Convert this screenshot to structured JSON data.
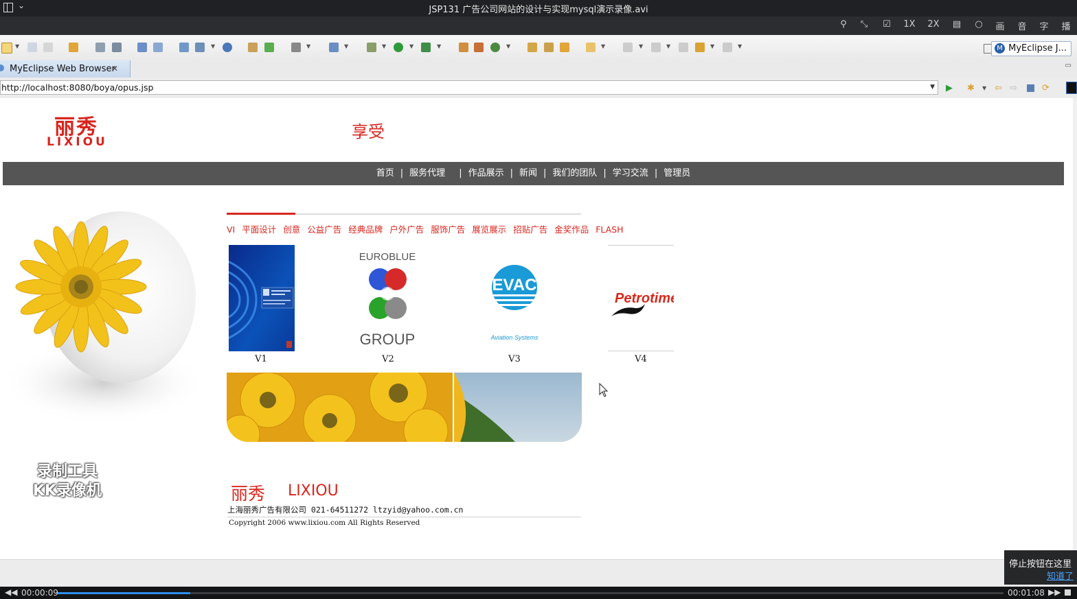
{
  "player": {
    "window_title": "JSP131 广告公司网站的设计与实现mysql演示录像.avi",
    "controls": [
      "1X",
      "2X",
      "画",
      "音",
      "字",
      "播"
    ],
    "time_current": "00:00:09",
    "time_total": "00:01:08",
    "progress_fraction": 0.14,
    "stop_hint": "停止按钮在这里",
    "stop_hint_link": "知道了"
  },
  "ide": {
    "perspective_label": "MyEclipse J...",
    "editor_tab": "MyEclipse Web Browser",
    "url": "http://localhost:8080/boya/opus.jsp"
  },
  "site": {
    "logo_cn": "丽秀",
    "logo_en": "LIXIOU",
    "slogan": "享受",
    "nav": [
      "首页",
      "服务代理",
      "作品展示",
      "新闻",
      "我们的团队",
      "学习交流",
      "管理员"
    ],
    "nav_separator": "|",
    "categories": [
      "VI",
      "平面设计",
      "创意",
      "公益广告",
      "经典品牌",
      "户外广告",
      "服饰广告",
      "展览展示",
      "招贴广告",
      "金奖作品",
      "FLASH"
    ],
    "works": [
      {
        "caption": "V1"
      },
      {
        "caption": "V2",
        "logo_text_top": "EUROBLUE",
        "logo_text_bottom": "GROUP"
      },
      {
        "caption": "V3",
        "logo_text": "EVAC",
        "logo_sub": "Aviation Systems"
      },
      {
        "caption": "V4",
        "logo_text": "Petrotime"
      }
    ],
    "watermark_line1": "录制工具",
    "watermark_line2": "KK录像机",
    "footer_logo_cn": "丽秀",
    "footer_logo_en": "LIXIOU",
    "footer_info": "上海丽秀广告有限公司 021-64511272 ltzyid@yahoo.com.cn",
    "footer_copyright": "Copyright 2006 www.lixiou.com All Rights Reserved"
  },
  "colors": {
    "brand_red": "#d7261e",
    "nav_bg": "#555555",
    "progress_blue": "#2e8ef0"
  }
}
